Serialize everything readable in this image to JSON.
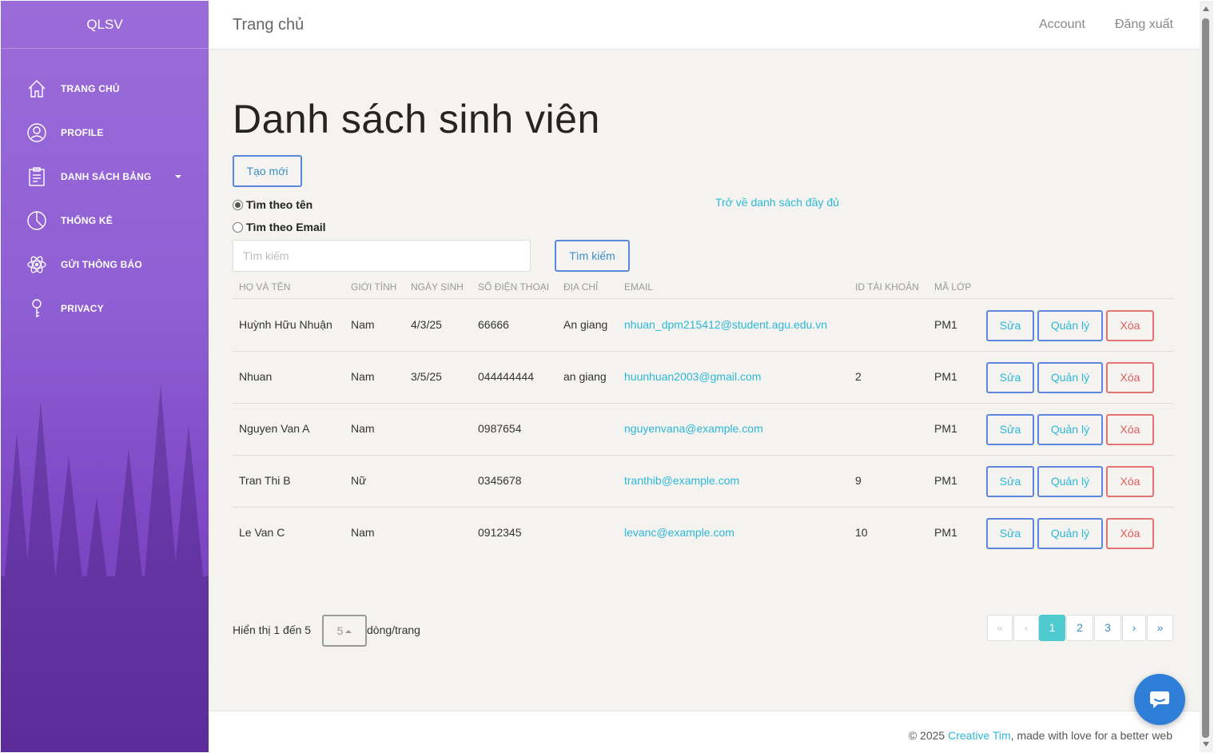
{
  "sidebar": {
    "brand": "QLSV",
    "items": [
      {
        "label": "TRANG CHỦ",
        "icon": "home-icon"
      },
      {
        "label": "PROFILE",
        "icon": "user-circle-icon"
      },
      {
        "label": "DANH SÁCH BẢNG",
        "icon": "clipboard-icon",
        "has_dropdown": true
      },
      {
        "label": "THỐNG KÊ",
        "icon": "pie-chart-icon"
      },
      {
        "label": "GỬI THÔNG BÁO",
        "icon": "atom-icon"
      },
      {
        "label": "PRIVACY",
        "icon": "key-icon"
      }
    ]
  },
  "topbar": {
    "title": "Trang chủ",
    "account": "Account",
    "logout": "Đăng xuất"
  },
  "main": {
    "heading": "Danh sách sinh viên",
    "create_label": "Tạo mới",
    "search_by_name": "Tìm theo tên",
    "search_by_email": "Tìm theo Email",
    "selected_search_mode": "name",
    "back_to_full": "Trở về danh sách đầy đủ",
    "search_placeholder": "Tìm kiếm",
    "search_button": "Tìm kiếm"
  },
  "table": {
    "headers": [
      "HỌ VÀ TÊN",
      "GIỚI TÍNH",
      "NGÀY SINH",
      "SỐ ĐIỆN THOẠI",
      "ĐỊA CHỈ",
      "EMAIL",
      "ID TÀI KHOẢN",
      "MÃ LỚP"
    ],
    "actions": {
      "edit": "Sửa",
      "manage": "Quản lý",
      "delete": "Xóa"
    },
    "rows": [
      {
        "name": "Huỳnh Hữu Nhuận",
        "gender": "Nam",
        "dob": "4/3/25",
        "phone": "66666",
        "address": "An giang",
        "email": "nhuan_dpm215412@student.agu.edu.vn",
        "account_id": "",
        "class": "PM1"
      },
      {
        "name": "Nhuan",
        "gender": "Nam",
        "dob": "3/5/25",
        "phone": "044444444",
        "address": "an giang",
        "email": "huunhuan2003@gmail.com",
        "account_id": "2",
        "class": "PM1"
      },
      {
        "name": "Nguyen Van A",
        "gender": "Nam",
        "dob": "",
        "phone": "0987654",
        "address": "",
        "email": "nguyenvana@example.com",
        "account_id": "",
        "class": "PM1"
      },
      {
        "name": "Tran Thi B",
        "gender": "Nữ",
        "dob": "",
        "phone": "0345678",
        "address": "",
        "email": "tranthib@example.com",
        "account_id": "9",
        "class": "PM1"
      },
      {
        "name": "Le Van C",
        "gender": "Nam",
        "dob": "",
        "phone": "0912345",
        "address": "",
        "email": "levanc@example.com",
        "account_id": "10",
        "class": "PM1"
      }
    ]
  },
  "pagination": {
    "showing": "Hiển thị 1 đến 5",
    "page_size": "5",
    "per_page_label": "dòng/trang",
    "first": "«",
    "prev": "‹",
    "pages": [
      "1",
      "2",
      "3"
    ],
    "current_page": "1",
    "next": "›",
    "last": "»"
  },
  "footer": {
    "prefix": "© 2025 ",
    "brand": "Creative Tim",
    "suffix": ", made with love for a better web"
  },
  "colors": {
    "sidebar_top": "#9b6cd8",
    "sidebar_bottom": "#6f38b6",
    "primary_outline": "#5d86dc",
    "info": "#2cb8d8",
    "danger": "#e05c5c",
    "active_page": "#4fcacf",
    "chat": "#2f7ed8"
  }
}
